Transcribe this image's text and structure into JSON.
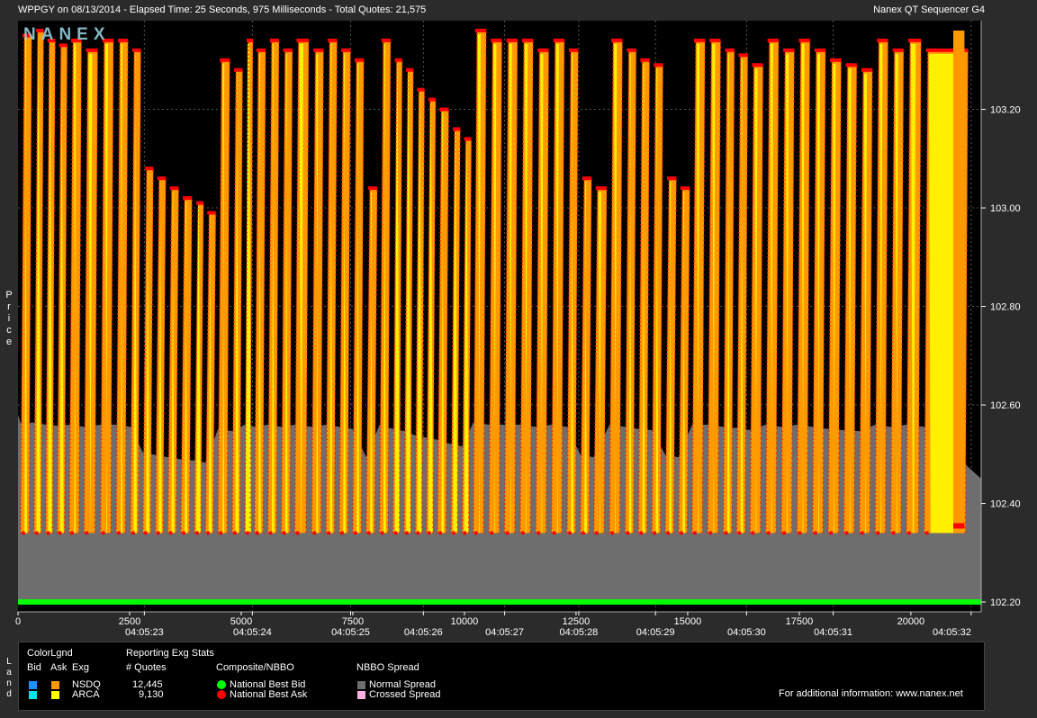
{
  "header": {
    "left": "WPPGY on 08/13/2014  -  Elapsed Time: 25 Seconds, 975 Milliseconds  -  Total Quotes: 21,575",
    "right": "Nanex QT Sequencer G4",
    "watermark": "NANEX"
  },
  "yaxis_label": "Price",
  "land_label": "Land",
  "legend": {
    "color_legend": "ColorLgnd",
    "bid": "Bid",
    "ask": "Ask",
    "exg": "Exg",
    "reporting": "Reporting Exg Stats",
    "num_quotes": "# Quotes",
    "composite": "Composite/NBBO",
    "nbbo_spread": "NBBO Spread",
    "rows": [
      {
        "exg": "NSDQ",
        "quotes": "12,445",
        "bid_color": "#1e90ff",
        "ask_color": "#ff9900"
      },
      {
        "exg": "ARCA",
        "quotes": "9,130",
        "bid_color": "#00e5e5",
        "ask_color": "#ffff00"
      }
    ],
    "nbb": "National Best Bid",
    "nbb_color": "#00ff00",
    "nba": "National Best Ask",
    "nba_color": "#ff0000",
    "normal_spread": "Normal Spread",
    "normal_spread_color": "#6e6e6e",
    "crossed_spread": "Crossed Spread",
    "crossed_spread_color": "#ffb0e0",
    "info": "For additional information: www.nanex.net"
  },
  "chart_data": {
    "type": "area",
    "title": "WPPGY on 08/13/2014",
    "xlabel": "",
    "ylabel": "Price",
    "xlim": [
      0,
      21575
    ],
    "ylim": [
      102.18,
      103.38
    ],
    "y_ticks": [
      "103.20",
      "103.00",
      "102.80",
      "102.60",
      "102.40",
      "102.20"
    ],
    "y_tick_values": [
      103.2,
      103.0,
      102.8,
      102.6,
      102.4,
      102.2
    ],
    "x_ticks": [
      "0",
      "2500",
      "5000",
      "7500",
      "10000",
      "12500",
      "15000",
      "17500",
      "20000"
    ],
    "x_tick_values": [
      0,
      2500,
      5000,
      7500,
      10000,
      12500,
      15000,
      17500,
      20000
    ],
    "time_ticks": [
      "04:05:23",
      "04:05:24",
      "04:05:25",
      "04:05:26",
      "04:05:27",
      "04:05:28",
      "04:05:29",
      "04:05:30",
      "04:05:31",
      "04:05:32"
    ],
    "time_tick_positions": [
      2830,
      5250,
      7450,
      9080,
      10900,
      12560,
      14280,
      16320,
      18260,
      21350
    ],
    "grid": true,
    "series": [
      {
        "name": "National Best Bid",
        "values": [
          102.2
        ]
      },
      {
        "name": "National Best Ask",
        "values": [
          102.34,
          103.36
        ]
      }
    ],
    "ask_spikes": [
      {
        "x": 60,
        "top": 103.35
      },
      {
        "x": 360,
        "top": 103.36
      },
      {
        "x": 620,
        "top": 103.34
      },
      {
        "x": 880,
        "top": 103.33
      },
      {
        "x": 1150,
        "top": 103.34
      },
      {
        "x": 1480,
        "top": 103.32
      },
      {
        "x": 1850,
        "top": 103.34
      },
      {
        "x": 2200,
        "top": 103.34
      },
      {
        "x": 2520,
        "top": 103.32
      },
      {
        "x": 2800,
        "top": 103.08
      },
      {
        "x": 3080,
        "top": 103.06
      },
      {
        "x": 3360,
        "top": 103.04
      },
      {
        "x": 3650,
        "top": 103.02
      },
      {
        "x": 3950,
        "top": 103.01
      },
      {
        "x": 4200,
        "top": 102.99
      },
      {
        "x": 4480,
        "top": 103.3
      },
      {
        "x": 4800,
        "top": 103.28
      },
      {
        "x": 5080,
        "top": 103.34
      },
      {
        "x": 5300,
        "top": 103.32
      },
      {
        "x": 5600,
        "top": 103.34
      },
      {
        "x": 5900,
        "top": 103.32
      },
      {
        "x": 6200,
        "top": 103.34
      },
      {
        "x": 6580,
        "top": 103.32
      },
      {
        "x": 6900,
        "top": 103.34
      },
      {
        "x": 7200,
        "top": 103.32
      },
      {
        "x": 7500,
        "top": 103.3
      },
      {
        "x": 7800,
        "top": 103.04
      },
      {
        "x": 8100,
        "top": 103.34
      },
      {
        "x": 8400,
        "top": 103.3
      },
      {
        "x": 8650,
        "top": 103.28
      },
      {
        "x": 8900,
        "top": 103.24
      },
      {
        "x": 9150,
        "top": 103.22
      },
      {
        "x": 9400,
        "top": 103.2
      },
      {
        "x": 9700,
        "top": 103.16
      },
      {
        "x": 9950,
        "top": 103.14
      },
      {
        "x": 10200,
        "top": 103.36
      },
      {
        "x": 10550,
        "top": 103.34
      },
      {
        "x": 10900,
        "top": 103.34
      },
      {
        "x": 11250,
        "top": 103.34
      },
      {
        "x": 11600,
        "top": 103.32
      },
      {
        "x": 11950,
        "top": 103.34
      },
      {
        "x": 12300,
        "top": 103.32
      },
      {
        "x": 12600,
        "top": 103.06
      },
      {
        "x": 12900,
        "top": 103.04
      },
      {
        "x": 13250,
        "top": 103.34
      },
      {
        "x": 13600,
        "top": 103.32
      },
      {
        "x": 13900,
        "top": 103.3
      },
      {
        "x": 14200,
        "top": 103.29
      },
      {
        "x": 14500,
        "top": 103.06
      },
      {
        "x": 14800,
        "top": 103.04
      },
      {
        "x": 15100,
        "top": 103.34
      },
      {
        "x": 15450,
        "top": 103.34
      },
      {
        "x": 15800,
        "top": 103.32
      },
      {
        "x": 16100,
        "top": 103.31
      },
      {
        "x": 16400,
        "top": 103.29
      },
      {
        "x": 16750,
        "top": 103.34
      },
      {
        "x": 17100,
        "top": 103.32
      },
      {
        "x": 17450,
        "top": 103.34
      },
      {
        "x": 17800,
        "top": 103.32
      },
      {
        "x": 18150,
        "top": 103.3
      },
      {
        "x": 18500,
        "top": 103.29
      },
      {
        "x": 18850,
        "top": 103.28
      },
      {
        "x": 19200,
        "top": 103.34
      },
      {
        "x": 19550,
        "top": 103.32
      },
      {
        "x": 19900,
        "top": 103.34
      },
      {
        "x": 20300,
        "top": 103.32
      }
    ]
  }
}
